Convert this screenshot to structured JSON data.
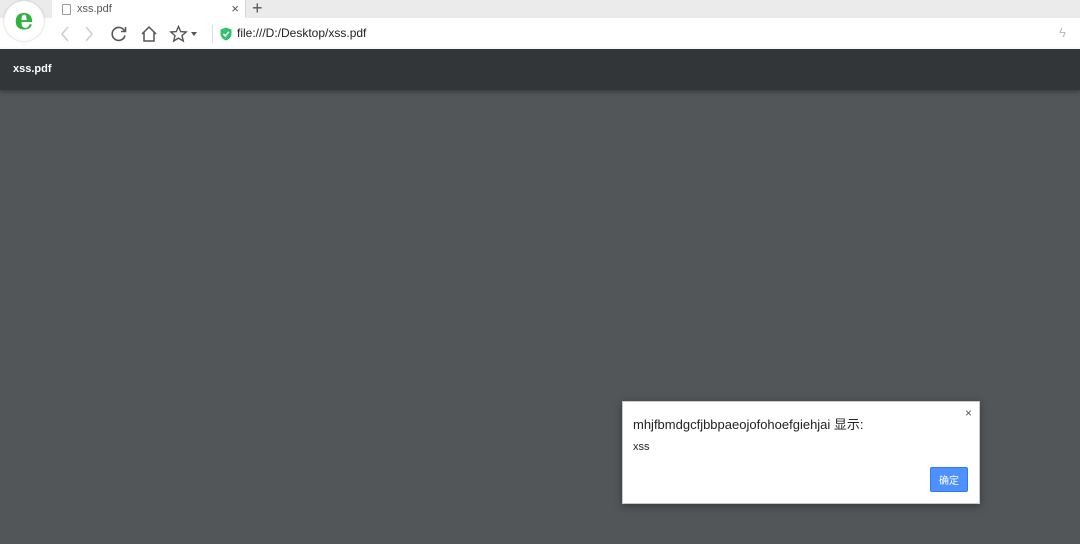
{
  "browser": {
    "tab": {
      "title": "xss.pdf",
      "close_glyph": "×"
    },
    "new_tab_glyph": "+",
    "logo_letter": "e",
    "address": {
      "url": "file:///D:/Desktop/xss.pdf"
    },
    "icons": [
      "back-icon",
      "forward-icon",
      "reload-icon",
      "home-icon",
      "star-icon",
      "dropdown-icon",
      "secure-shield-icon",
      "bolt-icon"
    ]
  },
  "pdf_viewer": {
    "title": "xss.pdf"
  },
  "dialog": {
    "title": "mhjfbmdgcfjbbpaeojofohoefgiehjai 显示:",
    "message": "xss",
    "ok_label": "确定",
    "close_glyph": "×"
  },
  "colors": {
    "viewer_background": "#525659",
    "viewer_header": "#323639",
    "ok_button": "#4d90fe",
    "brand_green": "#2fb33d"
  }
}
